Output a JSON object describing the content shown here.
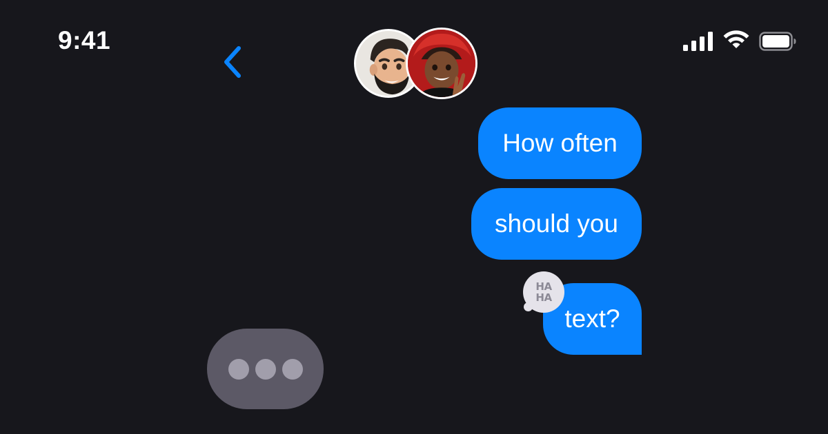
{
  "status_bar": {
    "time": "9:41",
    "icons": [
      "cellular-signal-icon",
      "wifi-icon",
      "battery-icon"
    ]
  },
  "nav": {
    "back_icon": "chevron-left-icon",
    "avatars": [
      "memoji-man-avatar",
      "memoji-woman-avatar"
    ]
  },
  "messages": [
    {
      "text": "How often",
      "direction": "outgoing"
    },
    {
      "text": "should you",
      "direction": "outgoing"
    },
    {
      "text": "text?",
      "direction": "outgoing",
      "tapback": "HA HA"
    }
  ],
  "tapback": {
    "line1": "HA",
    "line2": "HA"
  },
  "typing_indicator": {
    "dots": 3
  },
  "colors": {
    "background": "#17171c",
    "bubble": "#0a84ff",
    "accent": "#0a84ff",
    "typing_bubble": "#5c5966",
    "typing_dot": "#a19eab"
  }
}
